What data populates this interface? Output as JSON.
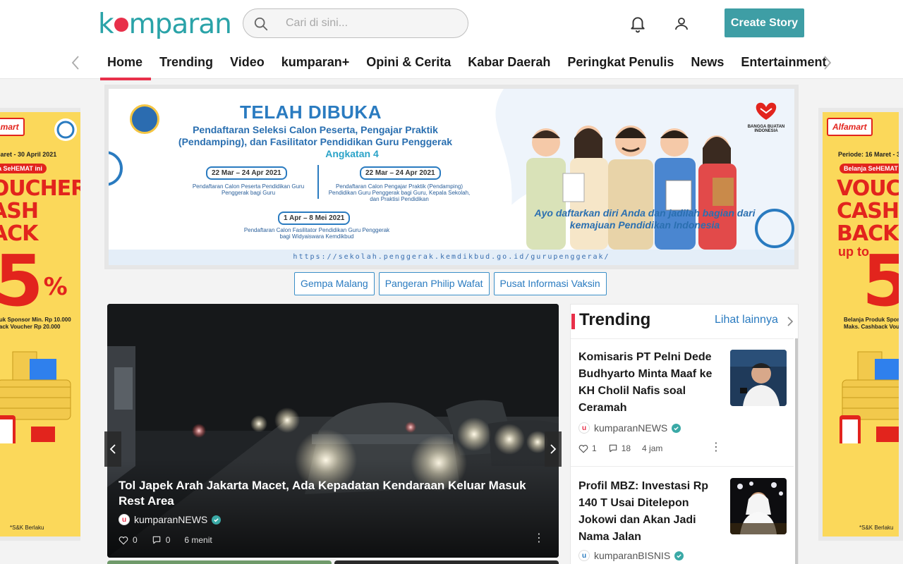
{
  "header": {
    "logo_text_a": "k",
    "logo_text_b": "mparan",
    "search_placeholder": "Cari di sini...",
    "create_story_label": "Create Story"
  },
  "nav": {
    "items": [
      "Home",
      "Trending",
      "Video",
      "kumparan+",
      "Opini & Cerita",
      "Kabar Daerah",
      "Peringkat Penulis",
      "News",
      "Entertainment"
    ],
    "active": "Home"
  },
  "side_ad": {
    "brand": "Alfamart",
    "period": "Periode: 16 Maret - 30 April 2021",
    "pill": "Belanja SeHEMAT ini",
    "big_line1": "VOUCHER",
    "big_line2": "CASH",
    "big_line3": "BACK",
    "percent": "5",
    "percent_sign": "%",
    "up_to": "up to",
    "small_line1": "Belanja Produk Sponsor Min. Rp 10.000",
    "small_line2": "Maks. Cashback Voucher Rp 20.000",
    "footnote": "*S&K Berlaku"
  },
  "banner": {
    "title": "TELAH DIBUKA",
    "subtitle": "Pendaftaran Seleksi Calon Peserta, Pengajar Praktik (Pendamping), dan Fasilitator Pendidikan Guru Penggerak",
    "batch": "Angkatan 4",
    "date1": "22 Mar – 24 Apr 2021",
    "desc1": "Pendaftaran Calon Peserta Pendidikan Guru Penggerak bagi Guru",
    "date2": "22 Mar – 24 Apr 2021",
    "desc2": "Pendaftaran Calon Pengajar Praktik (Pendamping) Pendidikan Guru Penggerak bagi Guru, Kepala Sekolah, dan Praktisi Pendidikan",
    "date3": "1 Apr – 8 Mei 2021",
    "desc3": "Pendaftaran Calon Fasilitator Pendidikan Guru Penggerak bagi Widyaiswara Kemdikbud",
    "tagline": "Ayo daftarkan diri Anda dan jadilah bagian dari kemajuan Pendidikan Indonesia",
    "badge": "BANGGA BUATAN INDONESIA",
    "url": "https://sekolah.penggerak.kemdikbud.go.id/gurupenggerak/"
  },
  "topics": [
    "Gempa Malang",
    "Pangeran Philip Wafat",
    "Pusat Informasi Vaksin"
  ],
  "headline": {
    "title": "Tol Japek Arah Jakarta Macet, Ada Kepadatan Kendaraan Keluar Masuk Rest Area",
    "author": "kumparanNEWS",
    "likes": "0",
    "comments": "0",
    "time": "6 menit"
  },
  "trending": {
    "title": "Trending",
    "more_label": "Lihat lainnya",
    "items": [
      {
        "title": "Komisaris PT Pelni Dede Budhyarto Minta Maaf ke KH Cholil Nafis soal Ceramah",
        "author": "kumparanNEWS",
        "likes": "1",
        "comments": "18",
        "time": "4 jam"
      },
      {
        "title": "Profil MBZ: Investasi Rp 140 T Usai Ditelepon Jokowi dan Akan Jadi Nama Jalan",
        "author": "kumparanBISNIS"
      }
    ]
  },
  "colors": {
    "brand_teal": "#2aa3a8",
    "accent_red": "#e8304a",
    "button_teal": "#3e9ea5",
    "link_blue": "#2a7bc0"
  }
}
